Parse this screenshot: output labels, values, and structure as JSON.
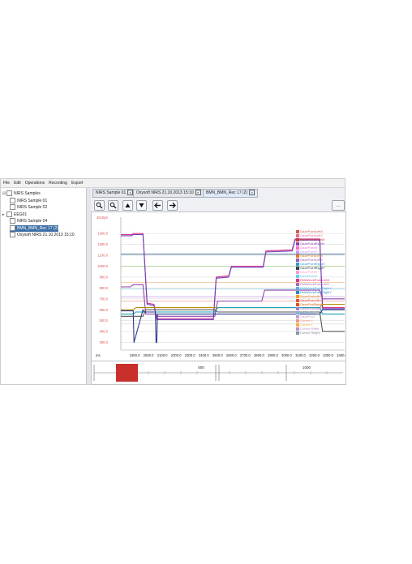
{
  "menu": [
    "File",
    "Edit",
    "Operations",
    "Recording",
    "Export"
  ],
  "tree": [
    {
      "label": "NIRS Samples",
      "level": 0,
      "expander": "⊟"
    },
    {
      "label": "NIRS Sample 01",
      "level": 1
    },
    {
      "label": "NIRS Sample 02",
      "level": 1
    },
    {
      "label": "EEG01",
      "level": 0,
      "expander": "▸"
    },
    {
      "label": "NIRS Sample 04",
      "level": 1
    },
    {
      "label": "BMN_BMN_Rec 17 (2)",
      "level": 1,
      "selected": true
    },
    {
      "label": "Oxysoft NIRS 21.10.2013 15:10",
      "level": 1
    }
  ],
  "tabs": [
    {
      "label": "NIRS Sample 01",
      "active": false
    },
    {
      "label": "Oxysoft NIRS 21.10.2013 15:10",
      "active": false
    },
    {
      "label": "BMN_BMN_Rec 17 (2)",
      "active": true
    }
  ],
  "toolbar": {
    "zoom_in_icon": "search-plus-icon",
    "zoom_out_icon": "search-minus-icon",
    "up_icon": "triangle-up-icon",
    "down_icon": "triangle-down-icon",
    "left_icon": "arrow-left-icon",
    "right_icon": "arrow-right-icon",
    "more_label": "..."
  },
  "colors": {
    "selection": "#3d6fa6",
    "nav_marker": "#c9302c",
    "axis_text": "#d9534f"
  },
  "chart_data": {
    "type": "line",
    "ylabel": "4ICSps",
    "xlabel": "ms",
    "y_ticks": [
      1300.0,
      1200.0,
      1100.0,
      1000.0,
      900.0,
      800.0,
      700.0,
      600.0,
      500.0,
      400.0,
      300.0
    ],
    "x_ticks": [
      1900.0,
      2000.0,
      2100.0,
      2200.0,
      2300.0,
      2400.0,
      2500.0,
      2600.0,
      2700.0,
      2800.0,
      2900.0,
      3000.0,
      3100.0,
      3200.0,
      3300.0,
      3400.0
    ],
    "xlim": [
      1800,
      3420
    ],
    "ylim": [
      230,
      1450
    ],
    "legend": [
      "GazePointLeftX",
      "GazePointLeftY",
      "GazePointRightX",
      "GazePointRightY",
      "GazePointX",
      "GazePointY",
      "GazePointLeftX",
      "GazePointLeftY",
      "GazePointRightX",
      "GazePointRightY",
      "GazePointX",
      "GazePointY",
      "EMAWorkPointLeftX",
      "EMAWorkPointLeftY",
      "EMAWorkPointRightX",
      "EMAWorkPointRightY",
      "GazePosLeftX",
      "GazePosLeftY",
      "GazePosRightX",
      "GazePosRightY",
      "GazePosX",
      "GazePosY",
      "Cursor X",
      "Cursor Y",
      "Cursor Width",
      "Cursor Height"
    ],
    "series": [
      {
        "color": "#d63384",
        "x": [
          1800,
          1880,
          1890,
          1960,
          1990,
          2040,
          2060,
          2160,
          2170,
          2470,
          2490,
          2580,
          2600,
          2830,
          2850,
          3040,
          3060,
          3240,
          3260,
          3420
        ],
        "values": [
          1290,
          1290,
          1300,
          1300,
          660,
          650,
          520,
          520,
          520,
          520,
          900,
          910,
          1000,
          1000,
          1140,
          1150,
          1250,
          1250,
          620,
          620
        ]
      },
      {
        "color": "#6f42c1",
        "x": [
          1800,
          1880,
          1890,
          1960,
          1990,
          2040,
          2060,
          2160,
          2170,
          2470,
          2490,
          2580,
          2600,
          2830,
          2850,
          3040,
          3060,
          3240,
          3260,
          3420
        ],
        "values": [
          1280,
          1280,
          1290,
          1290,
          650,
          640,
          510,
          510,
          510,
          510,
          890,
          900,
          990,
          990,
          1130,
          1140,
          1240,
          1240,
          610,
          610
        ]
      },
      {
        "color": "#8e44ad",
        "x": [
          1800,
          1870,
          1890,
          1960,
          1980,
          2050,
          2070,
          2480,
          2500,
          2820,
          2840,
          3240,
          3260,
          3420
        ],
        "values": [
          810,
          810,
          830,
          830,
          560,
          560,
          540,
          540,
          680,
          680,
          780,
          780,
          700,
          700
        ]
      },
      {
        "color": "#b58a00",
        "x": [
          1800,
          1890,
          1910,
          3240,
          3260,
          3420
        ],
        "values": [
          600,
          600,
          620,
          620,
          650,
          650
        ]
      },
      {
        "color": "#17a2b8",
        "x": [
          1800,
          1890,
          1910,
          2480,
          2500,
          3240,
          3260,
          3420
        ],
        "values": [
          560,
          560,
          580,
          580,
          620,
          620,
          560,
          560
        ]
      },
      {
        "color": "#2c3e8f",
        "x": [
          1800,
          1890,
          1895,
          1960,
          1970,
          2050,
          2055,
          2060,
          2065,
          3240,
          3260,
          3420
        ],
        "values": [
          590,
          590,
          300,
          600,
          580,
          580,
          300,
          300,
          560,
          560,
          600,
          600
        ]
      },
      {
        "color": "#555555",
        "x": [
          1800,
          1960,
          1980,
          2480,
          2500,
          3240,
          3260,
          3420
        ],
        "values": [
          540,
          540,
          600,
          600,
          580,
          580,
          400,
          400
        ]
      }
    ],
    "hlines": [
      {
        "y": 1110,
        "color": "#2d5f8b"
      },
      {
        "y": 1000,
        "color": "#a8d08d"
      },
      {
        "y": 850,
        "color": "#f2c18d"
      },
      {
        "y": 790,
        "color": "#8fd3e8"
      },
      {
        "y": 720,
        "color": "#c49bd8"
      },
      {
        "y": 680,
        "color": "#e8a0a0"
      },
      {
        "y": 470,
        "color": "#d9d9d9"
      }
    ]
  },
  "navigator": {
    "labels": [
      "500",
      "1000"
    ]
  }
}
